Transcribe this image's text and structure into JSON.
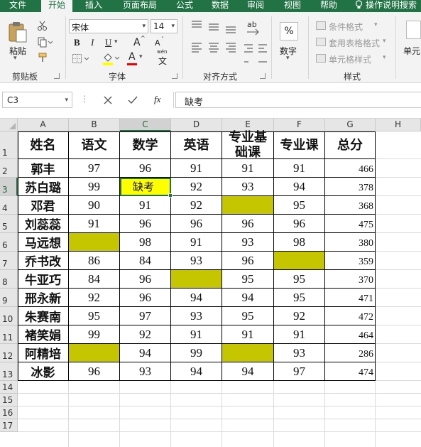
{
  "tabs": [
    {
      "label": "文件",
      "active": false
    },
    {
      "label": "开始",
      "active": true
    },
    {
      "label": "插入",
      "active": false
    },
    {
      "label": "页面布局",
      "active": false
    },
    {
      "label": "公式",
      "active": false
    },
    {
      "label": "数据",
      "active": false
    },
    {
      "label": "审阅",
      "active": false
    },
    {
      "label": "视图",
      "active": false
    },
    {
      "label": "帮助",
      "active": false
    },
    {
      "label": "操作说明搜索",
      "active": false
    }
  ],
  "ribbon": {
    "clipboard": {
      "paste_label": "粘贴",
      "group_label": "剪贴板"
    },
    "font": {
      "font_name": "宋体",
      "font_size": "14",
      "bold": "B",
      "italic": "I",
      "underline": "U",
      "grow": "A",
      "shrink": "A",
      "font_color_glyph": "A",
      "wen_label": "wén",
      "wen_glyph": "文",
      "group_label": "字体"
    },
    "alignment": {
      "group_label": "对齐方式",
      "wrap_glyph": "ab"
    },
    "number": {
      "label": "数字",
      "percent": "%"
    },
    "styles": {
      "conditional": "条件格式",
      "table": "套用表格格式",
      "cell_styles": "单元格样式",
      "group_label": "样式"
    },
    "cells": {
      "label": "单元"
    }
  },
  "formula_bar": {
    "name_box": "C3",
    "fx": "fx",
    "content": "缺考"
  },
  "colors": {
    "excel_green": "#217346",
    "highlight_olive": "#c6c600",
    "highlight_yellow": "#ffff00"
  },
  "sheet": {
    "columns": [
      "A",
      "B",
      "C",
      "D",
      "E",
      "F",
      "G",
      "H"
    ],
    "selected_column": "C",
    "selected_row": "3",
    "row_numbers": [
      "1",
      "2",
      "3",
      "4",
      "5",
      "6",
      "7",
      "8",
      "9",
      "10",
      "11",
      "12",
      "13",
      "14",
      "15",
      "16",
      "17"
    ],
    "header": [
      "姓名",
      "语文",
      "数学",
      "英语",
      "专业基础课",
      "专业课",
      "总分"
    ],
    "header_lines": {
      "e1": "专业基",
      "e2": "础课"
    },
    "rows": [
      {
        "name": "郭丰",
        "cells": [
          "97",
          "96",
          "91",
          "91",
          "91"
        ],
        "total": "466",
        "marks": [
          "",
          "",
          "",
          "",
          ""
        ]
      },
      {
        "name": "苏白璐",
        "cells": [
          "99",
          "缺考",
          "92",
          "93",
          "94"
        ],
        "total": "378",
        "marks": [
          "",
          "bright",
          "",
          "",
          ""
        ]
      },
      {
        "name": "邓君",
        "cells": [
          "90",
          "91",
          "92",
          "",
          "95"
        ],
        "total": "368",
        "marks": [
          "",
          "",
          "",
          "yel",
          ""
        ]
      },
      {
        "name": "刘蕊蕊",
        "cells": [
          "91",
          "96",
          "96",
          "96",
          "96"
        ],
        "total": "475",
        "marks": [
          "",
          "",
          "",
          "",
          ""
        ]
      },
      {
        "name": "马远想",
        "cells": [
          "",
          "98",
          "91",
          "93",
          "98"
        ],
        "total": "380",
        "marks": [
          "yel",
          "",
          "",
          "",
          ""
        ]
      },
      {
        "name": "乔书改",
        "cells": [
          "86",
          "84",
          "93",
          "96",
          ""
        ],
        "total": "359",
        "marks": [
          "",
          "",
          "",
          "",
          "yel"
        ]
      },
      {
        "name": "牛亚巧",
        "cells": [
          "84",
          "96",
          "",
          "95",
          "95"
        ],
        "total": "370",
        "marks": [
          "",
          "",
          "yel",
          "",
          ""
        ]
      },
      {
        "name": "邢永新",
        "cells": [
          "92",
          "96",
          "94",
          "94",
          "95"
        ],
        "total": "471",
        "marks": [
          "",
          "",
          "",
          "",
          ""
        ]
      },
      {
        "name": "朱赛南",
        "cells": [
          "95",
          "97",
          "93",
          "95",
          "92"
        ],
        "total": "472",
        "marks": [
          "",
          "",
          "",
          "",
          ""
        ]
      },
      {
        "name": "褚笑娟",
        "cells": [
          "99",
          "92",
          "91",
          "91",
          "91"
        ],
        "total": "464",
        "marks": [
          "",
          "",
          "",
          "",
          ""
        ]
      },
      {
        "name": "阿精培",
        "cells": [
          "",
          "94",
          "99",
          "",
          "93"
        ],
        "total": "286",
        "marks": [
          "yel",
          "",
          "",
          "yel",
          ""
        ]
      },
      {
        "name": "冰影",
        "cells": [
          "96",
          "93",
          "94",
          "94",
          "97"
        ],
        "total": "474",
        "marks": [
          "",
          "",
          "",
          "",
          ""
        ]
      }
    ]
  }
}
